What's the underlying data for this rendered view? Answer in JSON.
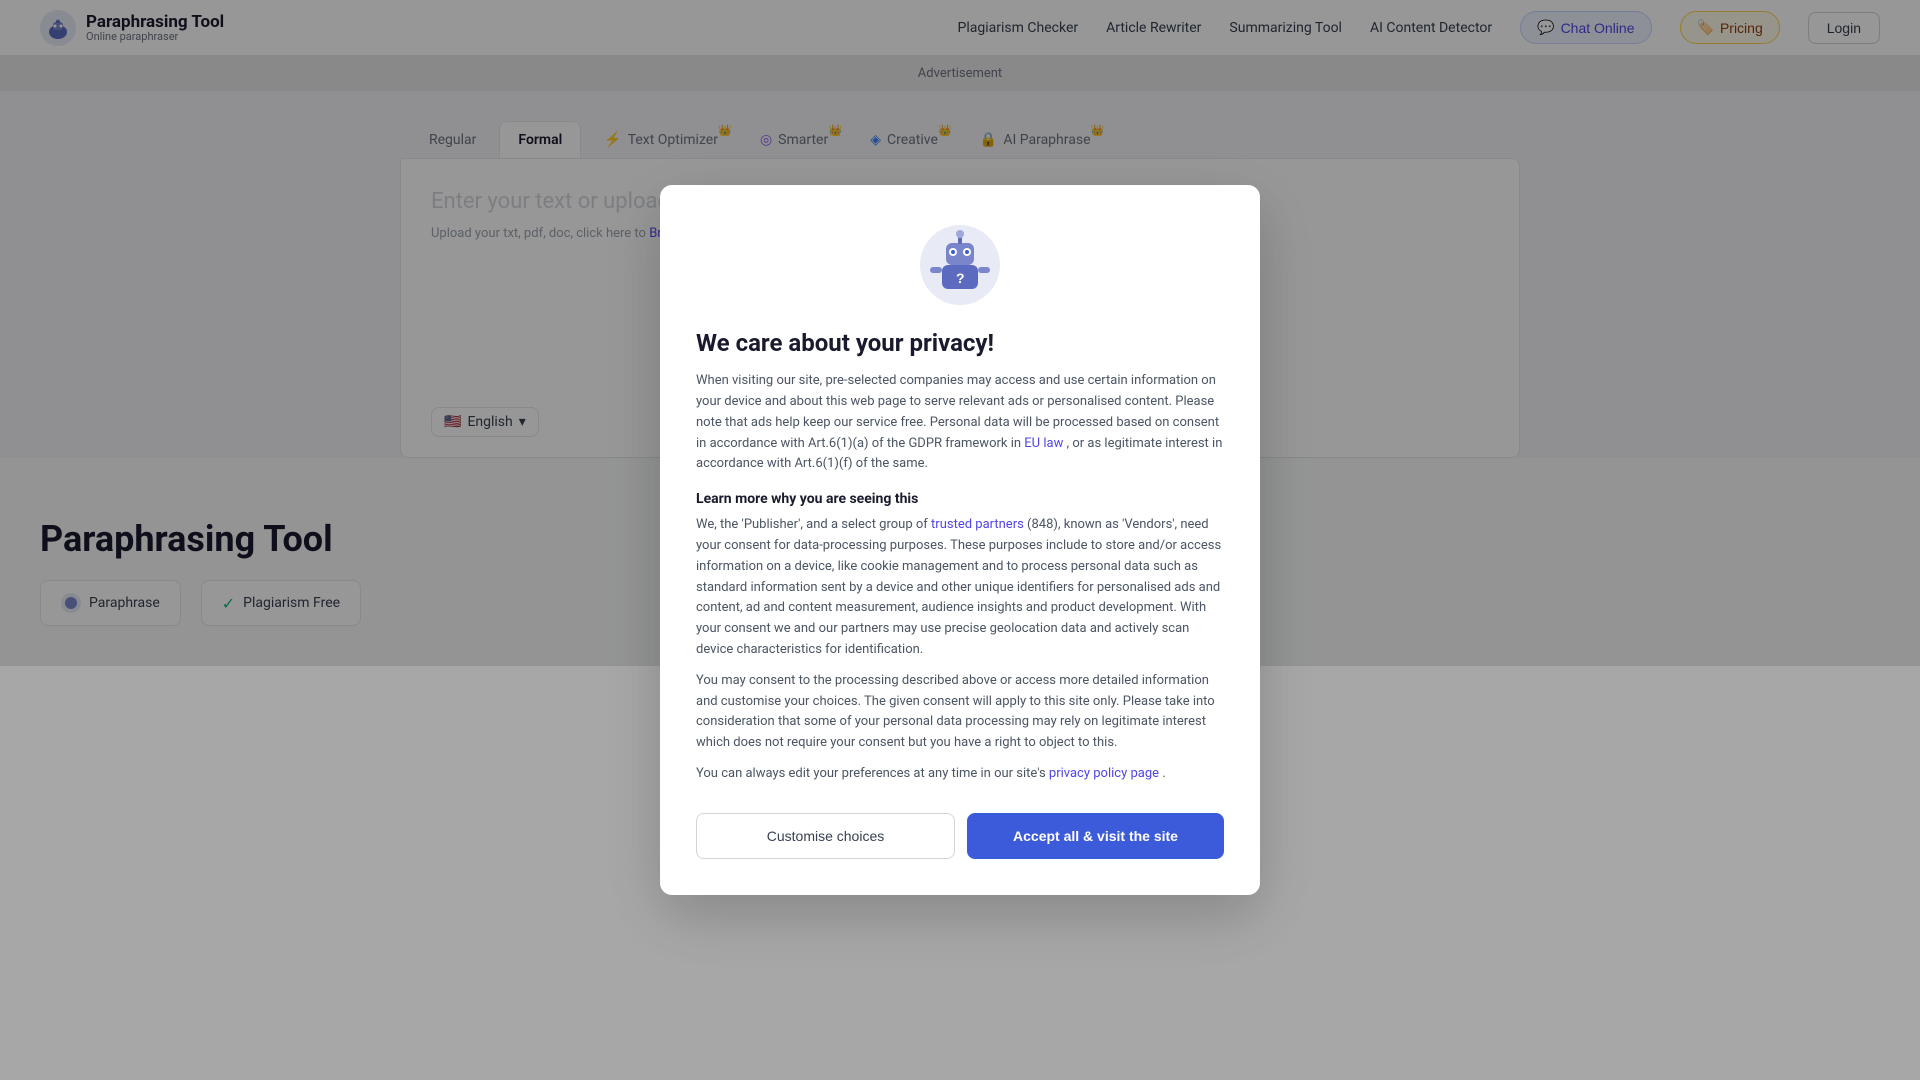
{
  "site": {
    "logo_text": "Paraphrasing Tool",
    "logo_sub": "Online paraphraser"
  },
  "nav": {
    "plagiarism_checker": "Plagiarism Checker",
    "article_rewriter": "Article Rewriter",
    "summarizing_tool": "Summarizing Tool",
    "ai_content_detector": "AI Content Detector",
    "chat_online": "Chat Online",
    "pricing": "Pricing",
    "login": "Login"
  },
  "ad_bar": {
    "text": "Advertisement"
  },
  "tabs": [
    {
      "id": "regular",
      "label": "Regular",
      "crown": false,
      "active": false
    },
    {
      "id": "formal",
      "label": "Formal",
      "crown": false,
      "active": true
    },
    {
      "id": "text-optimizer",
      "label": "Text Optimizer",
      "crown": true,
      "active": false
    },
    {
      "id": "smarter",
      "label": "Smarter",
      "crown": true,
      "active": false
    },
    {
      "id": "creative",
      "label": "Creative",
      "crown": true,
      "active": false
    },
    {
      "id": "ai-paraphrase",
      "label": "AI Paraphrase",
      "crown": true,
      "active": false
    }
  ],
  "editor": {
    "placeholder": "Enter your text or upload a file he...",
    "upload_hint": "Upload your txt, pdf, doc, click here to",
    "browse_link": "Browse f...",
    "language": "English"
  },
  "modal": {
    "title": "We care about your privacy!",
    "body_1": "When visiting our site, pre-selected companies may access and use certain information on your device and about this web page to serve relevant ads or personalised content. Please note that ads help keep our service free. Personal data will be processed based on consent in accordance with Art.6(1)(a) of the GDPR framework in",
    "eu_law": "EU law",
    "body_1_end": ", or as legitimate interest in accordance with Art.6(1)(f) of the same.",
    "section_title": "Learn more why you are seeing this",
    "body_2": "We, the 'Publisher', and a select group of",
    "trusted_partners": "trusted partners",
    "body_2_mid": "(848), known as 'Vendors', need your consent for data-processing purposes. These purposes include to store and/or access information on a device, like cookie management and to process personal data such as standard information sent by a device and other unique identifiers for personalised ads and content, ad and content measurement, audience insights and product development. With your consent we and our partners may use precise geolocation data and actively scan device characteristics for identification.",
    "body_3": "You may consent to the processing described above or access more detailed information and customise your choices. The given consent will apply to this site only. Please take into consideration that some of your personal data processing may rely on legitimate interest which does not require your consent but you have a right to object to this.",
    "body_4": "You can always edit your preferences at any time in our site's",
    "privacy_policy": "privacy policy page",
    "body_4_end": ".",
    "btn_customise": "Customise choices",
    "btn_accept": "Accept all & visit the site"
  },
  "footer": {
    "title": "Paraphrasing Tool",
    "paraphrase_label": "Paraphrase",
    "plagiarism_free": "Plagiarism Free"
  }
}
